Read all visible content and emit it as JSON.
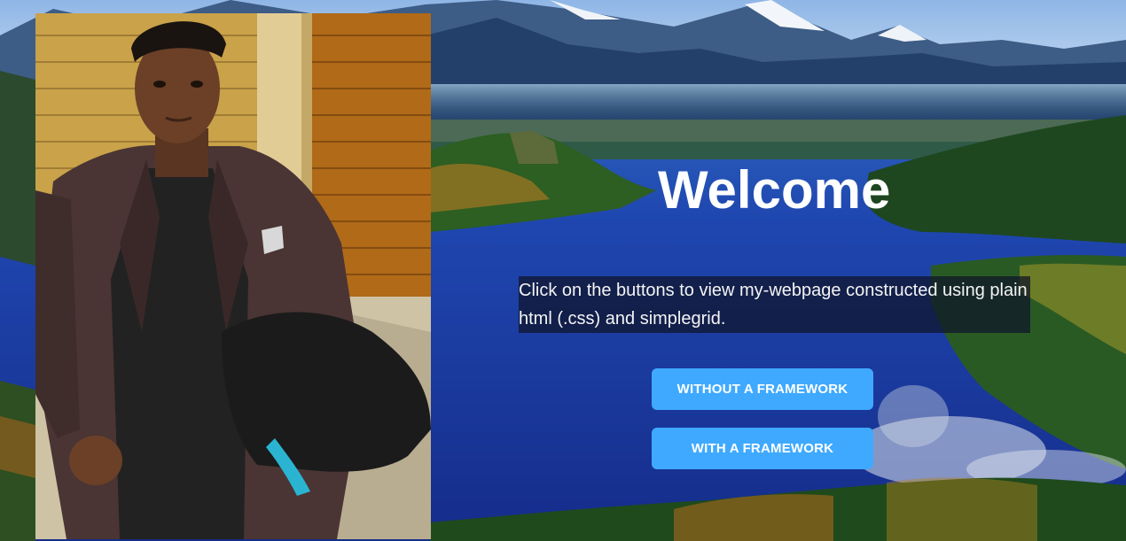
{
  "hero": {
    "title": "Welcome",
    "description": "Click on the buttons to view my-webpage constructed using plain html (.css) and simplegrid."
  },
  "buttons": {
    "without_framework": "WITHOUT A FRAMEWORK",
    "with_framework": "WITH A FRAMEWORK"
  },
  "colors": {
    "button_bg": "#3fa9ff",
    "button_text": "#ffffff",
    "title_text": "#ffffff",
    "text_panel_bg": "#0f1428"
  },
  "images": {
    "background": "mountain-lake-landscape",
    "portrait": "person-portrait-photo"
  }
}
